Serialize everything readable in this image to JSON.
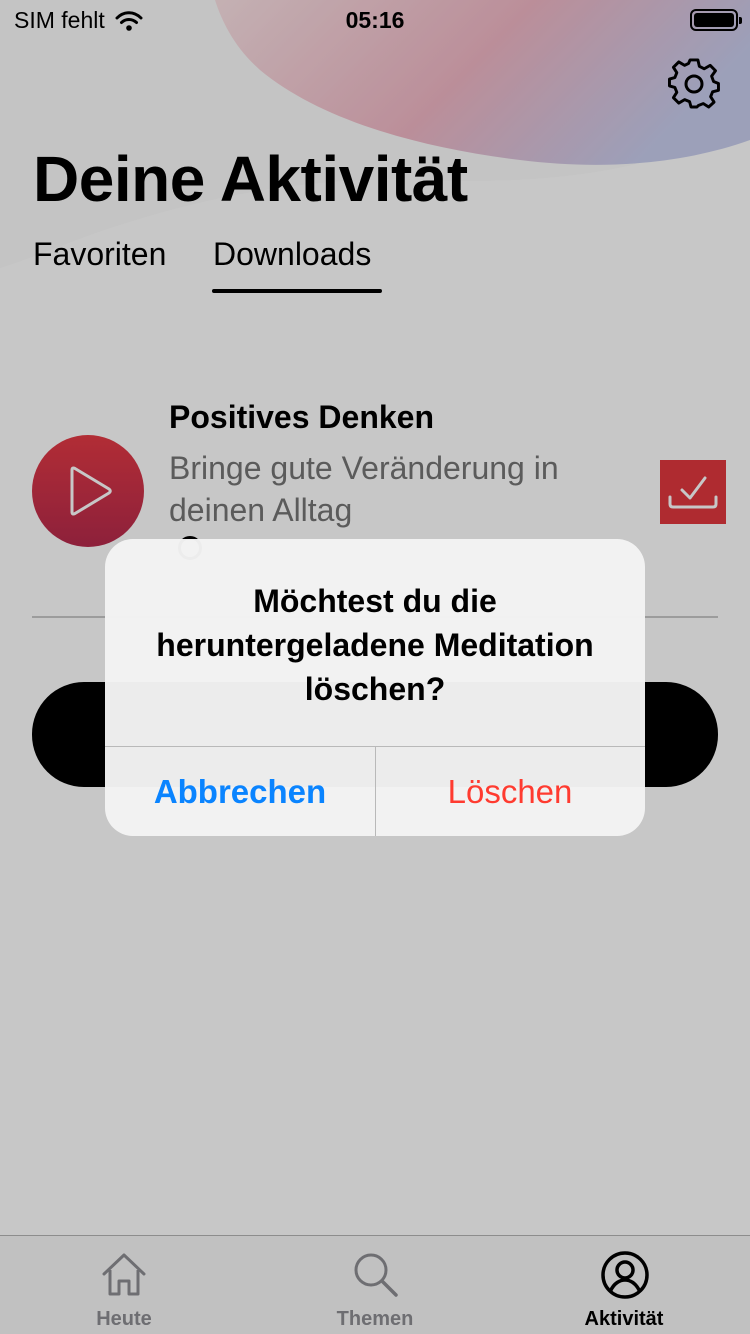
{
  "status_bar": {
    "carrier": "SIM fehlt",
    "time": "05:16"
  },
  "header": {
    "title": "Deine Aktivität"
  },
  "tabs": [
    {
      "label": "Favoriten",
      "selected": false
    },
    {
      "label": "Downloads",
      "selected": true
    }
  ],
  "download_item": {
    "title": "Positives Denken",
    "subtitle": "Bringe gute Veränderung in deinen Alltag"
  },
  "alert": {
    "message": "Möchtest du die heruntergeladene Meditation löschen?",
    "cancel_label": "Abbrechen",
    "delete_label": "Löschen"
  },
  "tab_bar": {
    "items": [
      {
        "label": "Heute",
        "icon": "home-icon",
        "selected": false
      },
      {
        "label": "Themen",
        "icon": "search-icon",
        "selected": false
      },
      {
        "label": "Aktivität",
        "icon": "profile-icon",
        "selected": true
      }
    ]
  },
  "colors": {
    "accent_red": "#e0383e",
    "cancel_blue": "#0a84ff",
    "delete_red": "#ff3b30",
    "inactive_gray": "#8e8e93"
  },
  "icons": [
    "wifi-icon",
    "battery-icon",
    "gear-icon",
    "play-icon",
    "download-done-icon"
  ]
}
